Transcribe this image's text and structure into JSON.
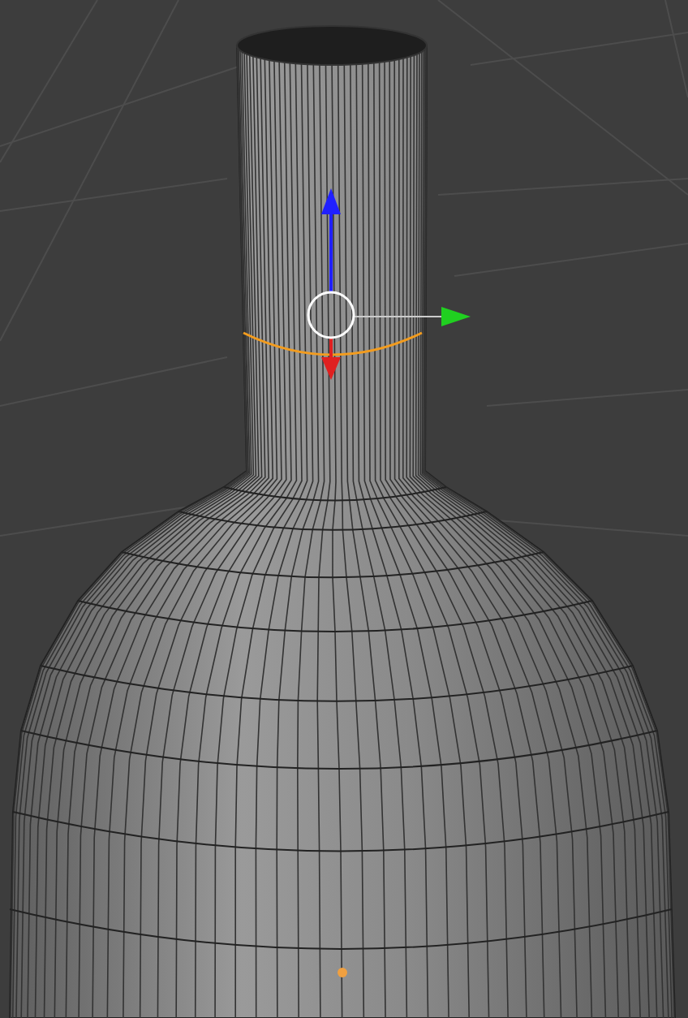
{
  "viewport": {
    "edge_loop_selected": true,
    "vertex_selected": true
  }
}
